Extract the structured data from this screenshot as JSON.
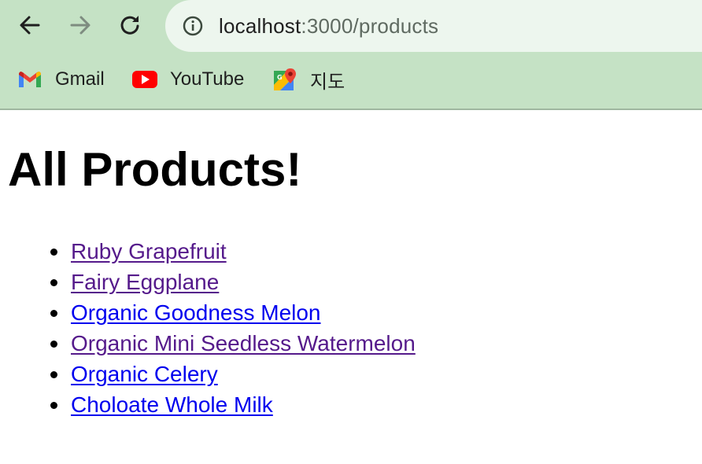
{
  "browser": {
    "url_host": "localhost",
    "url_path": ":3000/products",
    "bookmarks": [
      {
        "label": "Gmail",
        "icon": "gmail-icon"
      },
      {
        "label": "YouTube",
        "icon": "youtube-icon"
      },
      {
        "label": "지도",
        "icon": "maps-icon"
      }
    ]
  },
  "page": {
    "title": "All Products!",
    "products": [
      {
        "label": "Ruby Grapefruit",
        "visited": true
      },
      {
        "label": "Fairy Eggplane",
        "visited": true
      },
      {
        "label": "Organic Goodness Melon",
        "visited": false
      },
      {
        "label": "Organic Mini Seedless Watermelon",
        "visited": true
      },
      {
        "label": "Organic Celery",
        "visited": false
      },
      {
        "label": "Choloate Whole Milk",
        "visited": false
      }
    ]
  },
  "colors": {
    "chrome_bg": "#c5e2c5",
    "omnibox_bg": "#edf6ee",
    "link_visited": "#551a8b",
    "link_unvisited": "#0000ee"
  }
}
